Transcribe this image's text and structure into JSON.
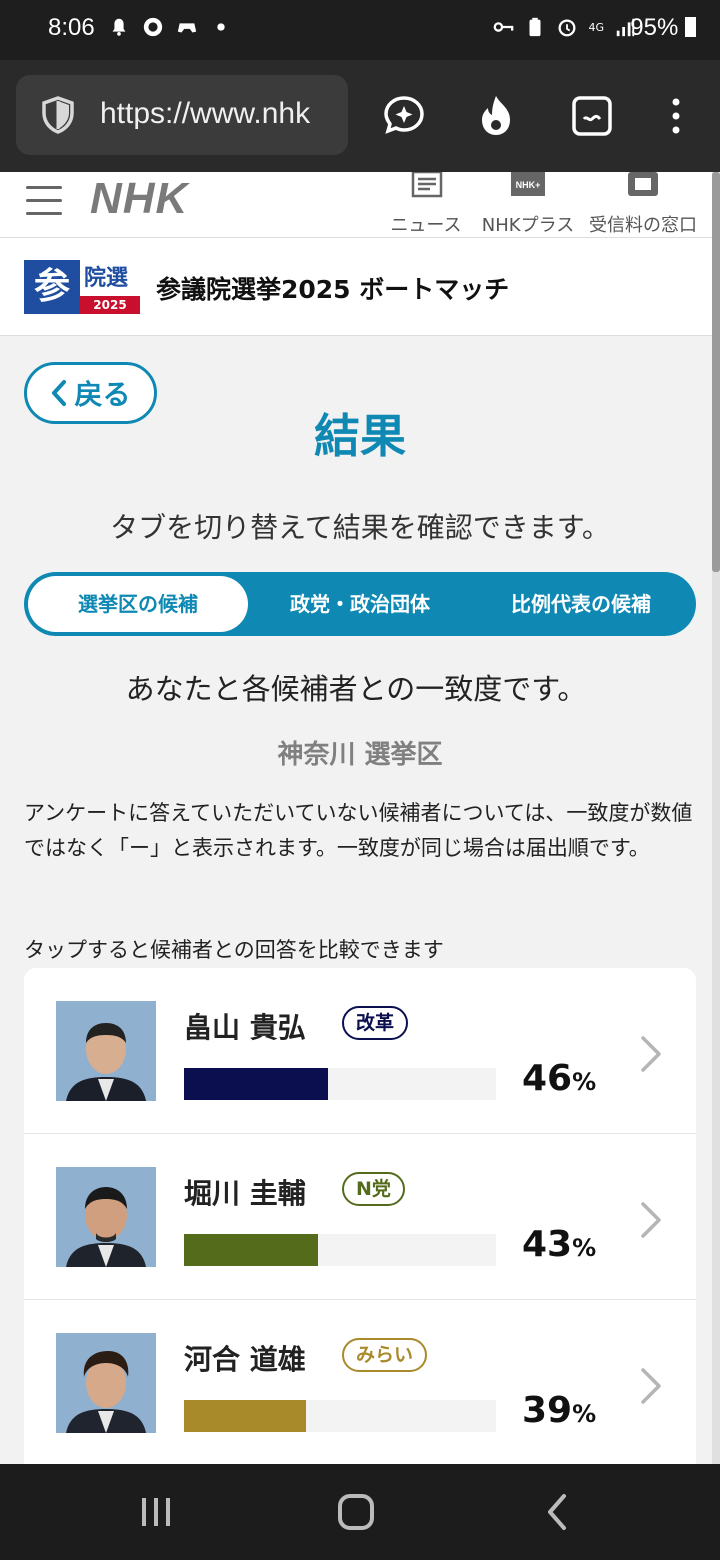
{
  "status_bar": {
    "time": "8:06",
    "battery": "95%",
    "network": "4G"
  },
  "browser": {
    "url": "https://www.nhk",
    "icons": [
      "shield-icon",
      "assistant-icon",
      "flame-icon",
      "tab-switcher-icon",
      "more-icon"
    ]
  },
  "site_header": {
    "logo": "NHK",
    "nav": [
      {
        "label": "ニュース",
        "icon": "news-icon"
      },
      {
        "label": "NHKプラス",
        "icon": "nhk-plus-icon"
      },
      {
        "label": "受信料の窓口",
        "icon": "fee-window-icon"
      }
    ]
  },
  "banner": {
    "badge_main": "参",
    "badge_sub": "院選",
    "badge_year": "2025",
    "title": "参議院選挙2025 ボートマッチ"
  },
  "main": {
    "back_label": "戻る",
    "title": "結果",
    "instruction": "タブを切り替えて結果を確認できます。",
    "tabs": [
      {
        "label": "選挙区の候補",
        "active": true
      },
      {
        "label": "政党・政治団体",
        "active": false
      },
      {
        "label": "比例代表の候補",
        "active": false
      }
    ],
    "match_heading": "あなたと各候補者との一致度です。",
    "district": "神奈川 選挙区",
    "note": "アンケートに答えていただいていない候補者については、一致度が数値ではなく「ー」と表示されます。一致度が同じ場合は届出順です。",
    "tap_hint": "タップすると候補者との回答を比較できます",
    "candidates": [
      {
        "name": "畠山 貴弘",
        "party": "改革",
        "party_color": "#0b0f4f",
        "bar_color": "#0b0f4f",
        "match": 46,
        "match_text": "46",
        "unit": "%"
      },
      {
        "name": "堀川 圭輔",
        "party": "N党",
        "party_color": "#556b1c",
        "bar_color": "#556b1c",
        "match": 43,
        "match_text": "43",
        "unit": "%"
      },
      {
        "name": "河合 道雄",
        "party": "みらい",
        "party_color": "#a88a2a",
        "bar_color": "#a88a2a",
        "match": 39,
        "match_text": "39",
        "unit": "%"
      }
    ]
  },
  "colors": {
    "accent": "#0f89b3",
    "badge_blue": "#1f4ea1",
    "badge_red": "#c8102e"
  }
}
